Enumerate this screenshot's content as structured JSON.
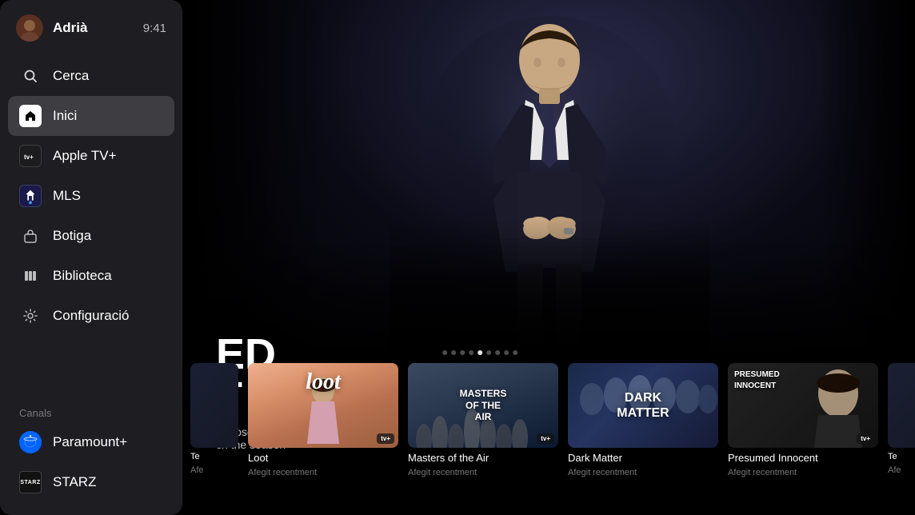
{
  "user": {
    "name": "Adrià",
    "time": "9:41"
  },
  "sidebar": {
    "nav_items": [
      {
        "id": "search",
        "label": "Cerca",
        "icon": "search"
      },
      {
        "id": "home",
        "label": "Inici",
        "icon": "home",
        "active": true
      },
      {
        "id": "appletv",
        "label": "Apple TV+",
        "icon": "appletv"
      },
      {
        "id": "mls",
        "label": "MLS",
        "icon": "mls"
      },
      {
        "id": "store",
        "label": "Botiga",
        "icon": "store"
      },
      {
        "id": "library",
        "label": "Biblioteca",
        "icon": "library"
      },
      {
        "id": "settings",
        "label": "Configuració",
        "icon": "settings"
      }
    ],
    "channels_label": "Canals",
    "channels": [
      {
        "id": "paramount",
        "label": "Paramount+",
        "icon": "paramount"
      },
      {
        "id": "starz",
        "label": "STARZ",
        "icon": "starz"
      }
    ]
  },
  "hero": {
    "title_line1": "ED",
    "title_line2": "T",
    "subtitle_line1": "d prosecutor",
    "subtitle_line2": "ch the season"
  },
  "dots": {
    "count": 9,
    "active": 5
  },
  "cards": [
    {
      "id": "card-partial-left",
      "title": "Te",
      "subtitle": "Afe",
      "theme": "partial"
    },
    {
      "id": "card-loot",
      "title": "Loot",
      "subtitle": "Afegit recentment",
      "theme": "loot",
      "cover_text": "loot",
      "badge": "appletv"
    },
    {
      "id": "card-masters",
      "title": "Masters of the Air",
      "subtitle": "Afegit recentment",
      "theme": "masters",
      "cover_text": "MASTERS\nOF THE\nAIR",
      "badge": "appletv"
    },
    {
      "id": "card-darkmatter",
      "title": "Dark Matter",
      "subtitle": "Afegit recentment",
      "theme": "darkmatter",
      "cover_text": "DARK\nMATTER"
    },
    {
      "id": "card-presumed",
      "title": "Presumed Innocent",
      "subtitle": "Afegit recentment",
      "theme": "presumed",
      "cover_text": "PRESUMED\nINNOCENT",
      "badge": "appletv"
    },
    {
      "id": "card-partial-right",
      "title": "Te",
      "subtitle": "Afe",
      "theme": "partial"
    }
  ]
}
